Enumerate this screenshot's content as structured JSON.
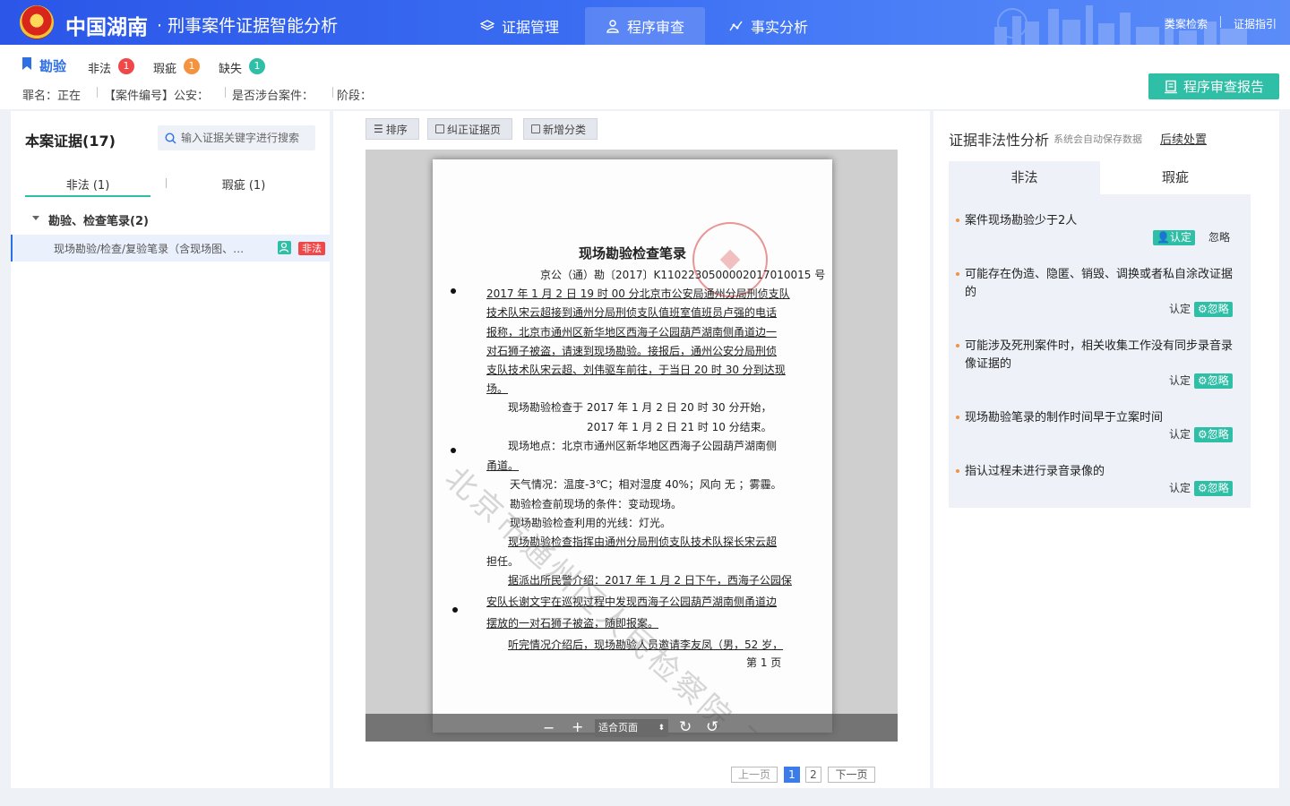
{
  "app": {
    "title": "中国湖南",
    "subtitle": "· 刑事案件证据智能分析",
    "nav_tabs": [
      {
        "label": "证据管理",
        "icon": "layers-icon"
      },
      {
        "label": "程序审查",
        "icon": "user-icon",
        "active": true
      },
      {
        "label": "事实分析",
        "icon": "analysis-icon"
      }
    ],
    "header_links": [
      "类案检索",
      "证据指引"
    ]
  },
  "case": {
    "type": "勘验",
    "stats": [
      {
        "label": "非法",
        "count": "1",
        "color": "#f04848"
      },
      {
        "label": "瑕疵",
        "count": "1",
        "color": "#f5923e"
      },
      {
        "label": "缺失",
        "count": "1",
        "color": "#2fbea6"
      }
    ],
    "meta": [
      "罪名：正在",
      "【案件编号】公安：",
      "是否涉台案件：",
      "阶段："
    ],
    "report_button": "程序审查报告"
  },
  "evidence": {
    "title": "本案证据(17)",
    "search_placeholder": "输入证据关键字进行搜索",
    "tabs": [
      "非法 (1)",
      "瑕疵 (1)"
    ],
    "group": "勘验、检查笔录(2)",
    "item": {
      "label": "现场勘验/检查/复验笔录（含现场图、…",
      "tag": "非法"
    }
  },
  "toolbar": {
    "sort": "排序",
    "correct": "纠正证据页",
    "add_category": "新增分类"
  },
  "document": {
    "title": "现场勘验检查笔录",
    "number": "京公（通）勘〔2017〕K1102230500002017010015 号",
    "lines": [
      "2017 年 1 月 2 日 19 时 00 分北京市公安局通州分局刑侦支队",
      "技术队宋云超接到通州分局刑侦支队值班室值班员卢强的电话",
      "报称，北京市通州区新华地区西海子公园葫芦湖南侧甬道边一",
      "对石狮子被盗，请速到现场勘验。接报后，通州公安分局刑侦",
      "支队技术队宋云超、刘伟驱车前往，于当日 20 时 30 分到达现",
      "场。",
      "现场勘验检查于 2017 年 1 月 2 日 20 时 30 分开始，",
      "2017 年 1 月 2 日 21 时 10 分结束。",
      "现场地点：北京市通州区新华地区西海子公园葫芦湖南侧",
      "甬道。",
      "天气情况：温度-3℃；相对湿度 40%；风向 无 ；雾霾。",
      "勘验检查前现场的条件：变动现场。",
      "现场勘验检查利用的光线：灯光。",
      "现场勘验检查指挥由通州分局刑侦支队技术队探长宋云超",
      "担任。",
      "据派出所民警介绍：2017 年 1 月 2 日下午，西海子公园保",
      "安队长谢文宇在巡视过程中发现西海子公园葫芦湖南侧甬道边",
      "摆放的一对石狮子被盗，随即报案。",
      "听完情况介绍后，现场勘验人员邀请李友凤（男，52 岁，"
    ],
    "page_label": "第 1 页",
    "watermark": "北京市通州区人民检察院 王增",
    "zoom": "适合页面"
  },
  "pagination": {
    "prev": "上一页",
    "pages": [
      "1",
      "2"
    ],
    "current": "1",
    "next": "下一页"
  },
  "analysis": {
    "title": "证据非法性分析",
    "note": "系统会自动保存数据",
    "followup": "后续处置",
    "tabs": [
      "非法",
      "瑕疵"
    ],
    "confirm_label": "认定",
    "ignore_label": "忽略",
    "issues": [
      {
        "text": "案件现场勘验少于2人",
        "state": "confirmed"
      },
      {
        "text": "可能存在伪造、隐匿、销毁、调换或者私自涂改证据的",
        "state": "ignored"
      },
      {
        "text": "可能涉及死刑案件时，相关收集工作没有同步录音录像证据的",
        "state": "ignored"
      },
      {
        "text": "现场勘验笔录的制作时间早于立案时间",
        "state": "ignored"
      },
      {
        "text": "指认过程未进行录音录像的",
        "state": "ignored"
      }
    ]
  },
  "colors": {
    "primary": "#2f6fe4",
    "accent": "#2fbea6",
    "danger": "#f04848",
    "warning": "#f5923e"
  }
}
